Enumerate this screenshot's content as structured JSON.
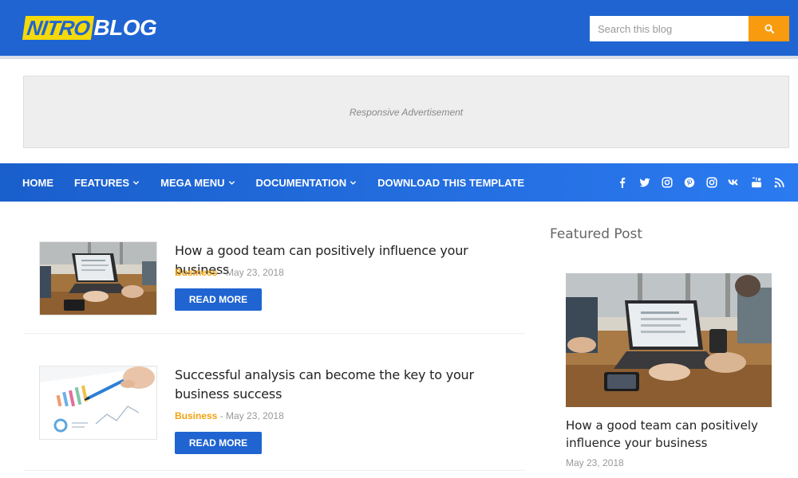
{
  "header": {
    "logo_part1": "NITRO",
    "logo_part2": "BLOG",
    "search_placeholder": "Search this blog",
    "search_icon": "search-icon",
    "bg_color": "#1f64d1",
    "accent_color": "#f99b0e",
    "logo_highlight": "#f5d90a"
  },
  "ad": {
    "text": "Responsive Advertisement"
  },
  "nav": {
    "items": [
      {
        "label": "HOME",
        "has_dropdown": false
      },
      {
        "label": "FEATURES",
        "has_dropdown": true
      },
      {
        "label": "MEGA MENU",
        "has_dropdown": true
      },
      {
        "label": "DOCUMENTATION",
        "has_dropdown": true
      },
      {
        "label": "DOWNLOAD THIS TEMPLATE",
        "has_dropdown": false
      }
    ],
    "social_icons": [
      "facebook-icon",
      "twitter-icon",
      "instagram-icon",
      "pinterest-icon",
      "instagram-icon",
      "vk-icon",
      "youtube-icon",
      "rss-icon"
    ]
  },
  "posts": [
    {
      "title": "How a good team can positively influence your business",
      "category": "Business",
      "date": "May 23, 2018",
      "read_more": "READ MORE",
      "image": "team-meeting-laptop-image"
    },
    {
      "title": "Successful analysis can become the key to your business success",
      "category": "Business",
      "date": "May 23, 2018",
      "read_more": "READ MORE",
      "image": "analysis-charts-pen-image"
    }
  ],
  "sidebar": {
    "heading": "Featured Post",
    "featured": {
      "title": "How a good team can positively influence your business",
      "date": "May 23, 2018",
      "image": "team-meeting-laptop-image"
    }
  }
}
